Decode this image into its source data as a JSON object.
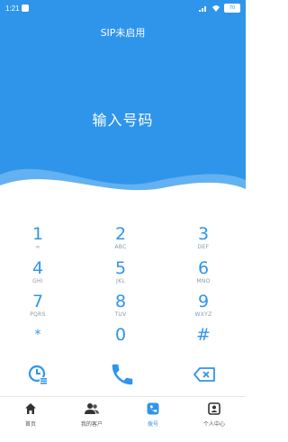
{
  "status_bar": {
    "time": "1:21",
    "battery": "70"
  },
  "header": {
    "sip_status": "SIP未启用",
    "number_placeholder": "输入号码"
  },
  "keypad": [
    {
      "digit": "1",
      "letters": "∞"
    },
    {
      "digit": "2",
      "letters": "ABC"
    },
    {
      "digit": "3",
      "letters": "DEF"
    },
    {
      "digit": "4",
      "letters": "GHI"
    },
    {
      "digit": "5",
      "letters": "JKL"
    },
    {
      "digit": "6",
      "letters": "MNO"
    },
    {
      "digit": "7",
      "letters": "PQRS"
    },
    {
      "digit": "8",
      "letters": "TUV"
    },
    {
      "digit": "9",
      "letters": "WXYZ"
    },
    {
      "digit": "*",
      "letters": ""
    },
    {
      "digit": "0",
      "letters": ""
    },
    {
      "digit": "#",
      "letters": ""
    }
  ],
  "actions": {
    "history_icon": "clock-history-icon",
    "call_icon": "phone-icon",
    "delete_icon": "backspace-icon"
  },
  "nav": [
    {
      "label": "首页",
      "icon": "home-icon",
      "active": false
    },
    {
      "label": "我的客户",
      "icon": "customers-icon",
      "active": false
    },
    {
      "label": "拨号",
      "icon": "dialpad-icon",
      "active": true
    },
    {
      "label": "个人中心",
      "icon": "profile-icon",
      "active": false
    }
  ],
  "colors": {
    "primary": "#2f95ea",
    "text_gray": "#8a98a8"
  }
}
